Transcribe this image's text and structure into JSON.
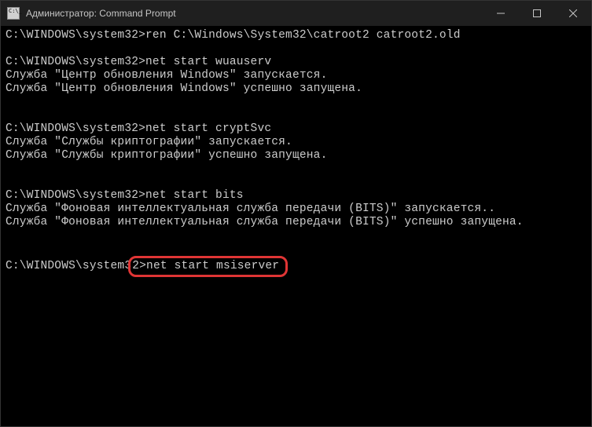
{
  "titlebar": {
    "title": "Администратор: Command Prompt"
  },
  "terminal": {
    "prompt": "C:\\WINDOWS\\system32>",
    "prompt_partial_prefix": "C:\\WINDOWS\\system3",
    "prompt_partial_suffix": "2>",
    "lines": {
      "l1_cmd": "ren C:\\Windows\\System32\\catroot2 catroot2.old",
      "l2_cmd": "net start wuauserv",
      "l3_out1": "Служба \"Центр обновления Windows\" запускается.",
      "l3_out2": "Служба \"Центр обновления Windows\" успешно запущена.",
      "l4_cmd": "net start cryptSvc",
      "l5_out1": "Служба \"Службы криптографии\" запускается.",
      "l5_out2": "Служба \"Службы криптографии\" успешно запущена.",
      "l6_cmd": "net start bits",
      "l7_out1": "Служба \"Фоновая интеллектуальная служба передачи (BITS)\" запускается..",
      "l7_out2": "Служба \"Фоновая интеллектуальная служба передачи (BITS)\" успешно запущена.",
      "l8_cmd": "net start msiserver"
    }
  }
}
